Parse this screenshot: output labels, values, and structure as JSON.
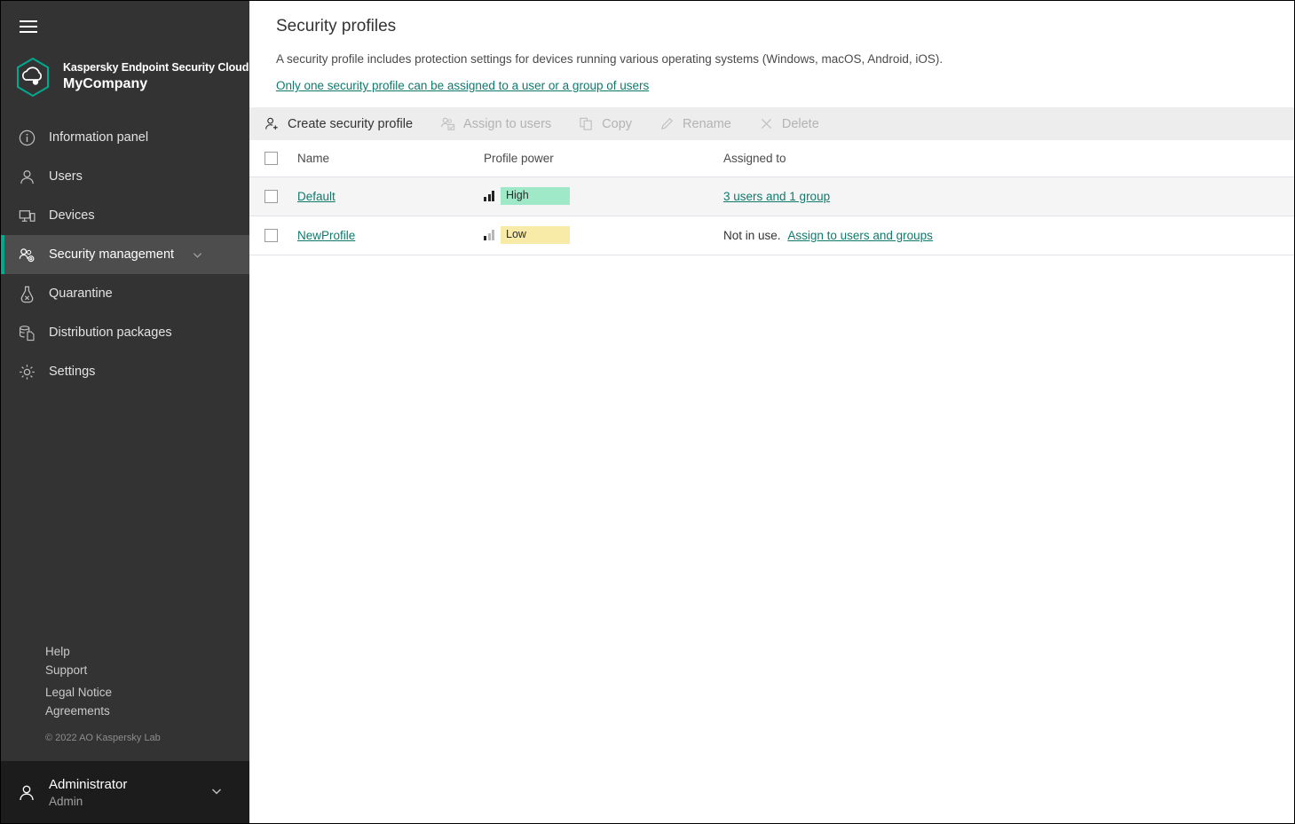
{
  "sidebar": {
    "menu_icon": "hamburger-icon",
    "brand": {
      "logo_icon": "kaspersky-hexagon-cloud-logo",
      "product": "Kaspersky Endpoint Security Cloud",
      "company": "MyCompany"
    },
    "items": [
      {
        "label": "Information panel",
        "icon": "info-circle-icon",
        "active": false,
        "chevron": false
      },
      {
        "label": "Users",
        "icon": "user-icon",
        "active": false,
        "chevron": false
      },
      {
        "label": "Devices",
        "icon": "devices-icon",
        "active": false,
        "chevron": false
      },
      {
        "label": "Security management",
        "icon": "users-gear-icon",
        "active": true,
        "chevron": true
      },
      {
        "label": "Quarantine",
        "icon": "flask-icon",
        "active": false,
        "chevron": false
      },
      {
        "label": "Distribution packages",
        "icon": "database-copy-icon",
        "active": false,
        "chevron": false
      },
      {
        "label": "Settings",
        "icon": "gear-icon",
        "active": false,
        "chevron": false
      }
    ],
    "footer_links": [
      "Help",
      "Support",
      "Legal Notice",
      "Agreements"
    ],
    "copyright": "© 2022 AO Kaspersky Lab",
    "user": {
      "icon": "user-avatar-icon",
      "name": "Administrator",
      "role": "Admin",
      "caret_icon": "chevron-down-icon"
    }
  },
  "main": {
    "title": "Security profiles",
    "description": "A security profile includes protection settings for devices running various operating systems (Windows, macOS, Android, iOS).",
    "info_link": "Only one security profile can be assigned to a user or a group of users",
    "toolbar": [
      {
        "label": "Create security profile",
        "icon": "user-plus-icon",
        "disabled": false
      },
      {
        "label": "Assign to users",
        "icon": "assign-users-icon",
        "disabled": true
      },
      {
        "label": "Copy",
        "icon": "copy-icon",
        "disabled": true
      },
      {
        "label": "Rename",
        "icon": "pencil-icon",
        "disabled": true
      },
      {
        "label": "Delete",
        "icon": "close-x-icon",
        "disabled": true
      }
    ],
    "table": {
      "columns": [
        "Name",
        "Profile power",
        "Assigned to"
      ],
      "rows": [
        {
          "name": "Default",
          "power": "High",
          "power_level": 3,
          "assigned_prefix": "",
          "assigned_link": "3 users and 1 group",
          "highlighted": true
        },
        {
          "name": "NewProfile",
          "power": "Low",
          "power_level": 1,
          "assigned_prefix": "Not in use.",
          "assigned_link": "Assign to users and groups",
          "highlighted": false
        }
      ]
    }
  },
  "colors": {
    "accent_teal": "#00a88e",
    "link_green": "#0f7a6c",
    "badge_high": "#9fe8c8",
    "badge_low": "#f7eba7",
    "sidebar_bg": "#333333",
    "toolbar_bg": "#ededed"
  }
}
